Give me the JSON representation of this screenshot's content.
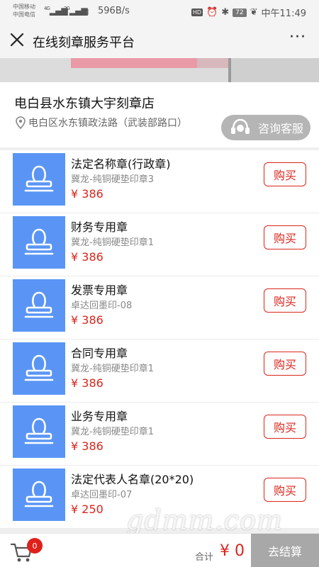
{
  "status": {
    "carrier1": "中国移动",
    "carrier2": "中国电信",
    "net1": "4G",
    "net2": "2G",
    "speed": "596B/s",
    "hd": "HD",
    "battery": "72",
    "time": "中午11:49"
  },
  "nav": {
    "title": "在线刻章服务平台",
    "more": "···"
  },
  "shop": {
    "name": "电白县水东镇大宇刻章店",
    "address": "电白区水东镇政法路（武装部路口）",
    "consult": "咨询客服"
  },
  "products": [
    {
      "name": "法定名称章(行政章)",
      "sub": "冀龙-纯铜硬垫印章3",
      "price": "¥ 386",
      "buy": "购买"
    },
    {
      "name": "财务专用章",
      "sub": "冀龙-纯铜硬垫印章1",
      "price": "¥ 386",
      "buy": "购买"
    },
    {
      "name": "发票专用章",
      "sub": "卓达回墨印-08",
      "price": "¥ 386",
      "buy": "购买"
    },
    {
      "name": "合同专用章",
      "sub": "冀龙-纯铜硬垫印章1",
      "price": "¥ 386",
      "buy": "购买"
    },
    {
      "name": "业务专用章",
      "sub": "冀龙-纯铜硬垫印章1",
      "price": "¥ 386",
      "buy": "购买"
    },
    {
      "name": "法定代表人名章(20*20)",
      "sub": "卓达回墨印-07",
      "price": "¥ 250",
      "buy": "购买"
    }
  ],
  "cart": {
    "count": "0",
    "total_label": "合计",
    "total": "¥ 0",
    "checkout": "去结算"
  },
  "watermark": "gdmm.com",
  "colors": {
    "accent": "#d9261c",
    "thumb": "#5a95f5",
    "checkout": "#a8a8a8"
  }
}
